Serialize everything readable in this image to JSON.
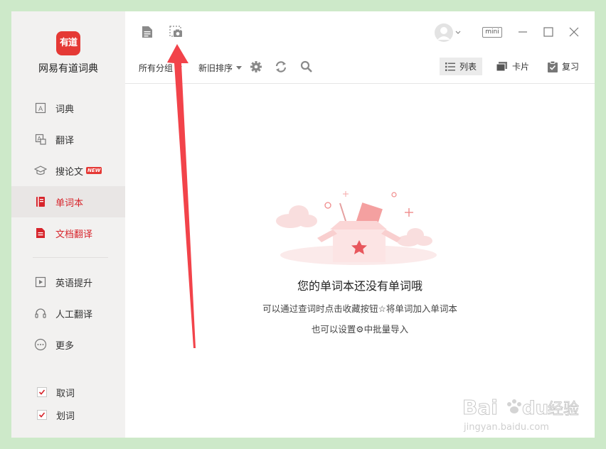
{
  "app": {
    "logo_text": "有道",
    "name": "网易有道词典"
  },
  "sidebar": {
    "items": [
      {
        "label": "词典",
        "icon": "dictionary-icon"
      },
      {
        "label": "翻译",
        "icon": "translate-icon"
      },
      {
        "label": "搜论文",
        "icon": "graduation-cap-icon",
        "badge": "NEW"
      },
      {
        "label": "单词本",
        "icon": "wordbook-icon",
        "active": true
      },
      {
        "label": "文档翻译",
        "icon": "document-translate-icon"
      },
      {
        "label": "英语提升",
        "icon": "video-play-icon"
      },
      {
        "label": "人工翻译",
        "icon": "headset-icon"
      },
      {
        "label": "更多",
        "icon": "more-dots-icon"
      }
    ],
    "checks": [
      {
        "label": "取词",
        "checked": true
      },
      {
        "label": "划词",
        "checked": true
      }
    ]
  },
  "toolbar": {
    "mini_label": "mini",
    "group_filter": "所有分组",
    "sort_filter": "新旧排序",
    "views": {
      "list": "列表",
      "card": "卡片",
      "review": "复习"
    }
  },
  "empty_state": {
    "title": "您的单词本还没有单词哦",
    "line1": "可以通过查词时点击收藏按钮☆将单词加入单词本",
    "line2": "也可以设置⚙中批量导入"
  },
  "watermark": {
    "brand": "Bai",
    "brand2": "du",
    "cn": "经验",
    "url": "jingyan.baidu.com"
  },
  "colors": {
    "accent": "#d7242b",
    "logo_bg": "#e53935",
    "arrow": "#f2434a",
    "desktop_bg": "#cde9c9"
  }
}
